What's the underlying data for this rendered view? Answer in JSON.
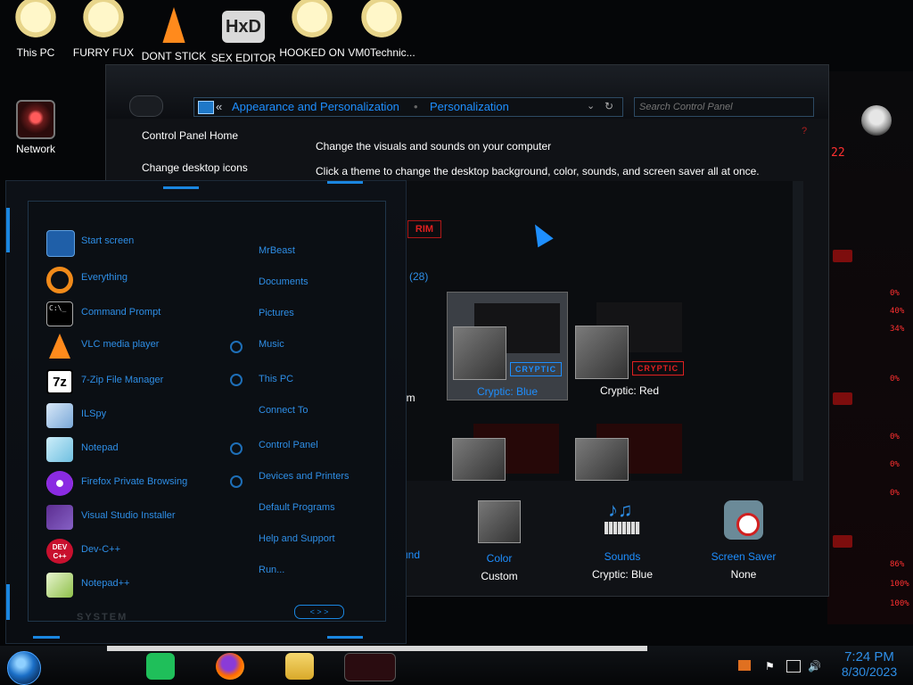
{
  "desktop_icons": [
    {
      "label": "This PC",
      "icon": "cartoon-face-icon"
    },
    {
      "label": "FURRY FUX",
      "icon": "cartoon-face-icon"
    },
    {
      "label": "DONT STICK",
      "icon": "vlc-cone-icon"
    },
    {
      "label": "SEX EDITOR",
      "icon": "hxd-icon"
    },
    {
      "label": "HOOKED ON",
      "icon": "cartoon-face-icon"
    },
    {
      "label": "VM0Technic...",
      "icon": "cartoon-face-icon"
    },
    {
      "label": "Network",
      "icon": "network-icon"
    }
  ],
  "control_panel": {
    "breadcrumb": [
      "Appearance and Personalization",
      "Personalization"
    ],
    "nav_back_glyph": "«",
    "search_placeholder": "Search Control Panel",
    "left_links": [
      "Control Panel Home",
      "Change desktop icons"
    ],
    "heading": "Change the visuals and sounds on your computer",
    "subheading": "Click a theme to change the desktop background, color, sounds, and screen saver all at once.",
    "theme_count": "(28)",
    "partial_caption": "am",
    "partial_tag": "RIM",
    "themes": [
      {
        "name": "Cryptic: Blue",
        "tag": "CRYPTIC",
        "tag_color": "#1e8fff",
        "selected": true
      },
      {
        "name": "Cryptic: Red",
        "tag": "CRYPTIC",
        "tag_color": "#e02020",
        "selected": false
      }
    ],
    "bottom": [
      {
        "title": "und",
        "value": ""
      },
      {
        "title": "Color",
        "value": "Custom"
      },
      {
        "title": "Sounds",
        "value": "Cryptic: Blue"
      },
      {
        "title": "Screen Saver",
        "value": "None"
      }
    ]
  },
  "start_menu": {
    "pinned": [
      {
        "label": "Start screen",
        "icon": "start-screen-icon"
      },
      {
        "label": "Everything",
        "icon": "magnifier-icon"
      },
      {
        "label": "Command Prompt",
        "icon": "cmd-icon"
      },
      {
        "label": "VLC media player",
        "icon": "vlc-cone-icon"
      },
      {
        "label": "7-Zip File Manager",
        "icon": "sevenzip-icon"
      },
      {
        "label": "ILSpy",
        "icon": "ilspy-icon"
      },
      {
        "label": "Notepad",
        "icon": "notepad-icon"
      },
      {
        "label": "Firefox Private Browsing",
        "icon": "firefox-private-icon"
      },
      {
        "label": "Visual Studio Installer",
        "icon": "visual-studio-icon"
      },
      {
        "label": "Dev-C++",
        "icon": "devcpp-icon"
      },
      {
        "label": "Notepad++",
        "icon": "notepadpp-icon"
      }
    ],
    "places": [
      "MrBeast",
      "Documents",
      "Pictures",
      "Music",
      "This PC",
      "Connect To",
      "Control Panel",
      "Devices and Printers",
      "Default Programs",
      "Help and Support",
      "Run..."
    ],
    "sevenzip_text": "7z",
    "devcpp_text": "DEV C++",
    "cmd_text": "C:\\_",
    "footer": "SYSTEM",
    "pager": "< > >"
  },
  "rail": {
    "stats": [
      "0%",
      "40%",
      "34%",
      "0%",
      "0%",
      "0%",
      "0%",
      "86%",
      "100%",
      "100%"
    ],
    "top_text": "22"
  },
  "taskbar": {
    "time": "7:24 PM",
    "date": "8/30/2023"
  },
  "colors": {
    "accent_blue": "#1e8fff",
    "alien_red": "#e02020"
  }
}
